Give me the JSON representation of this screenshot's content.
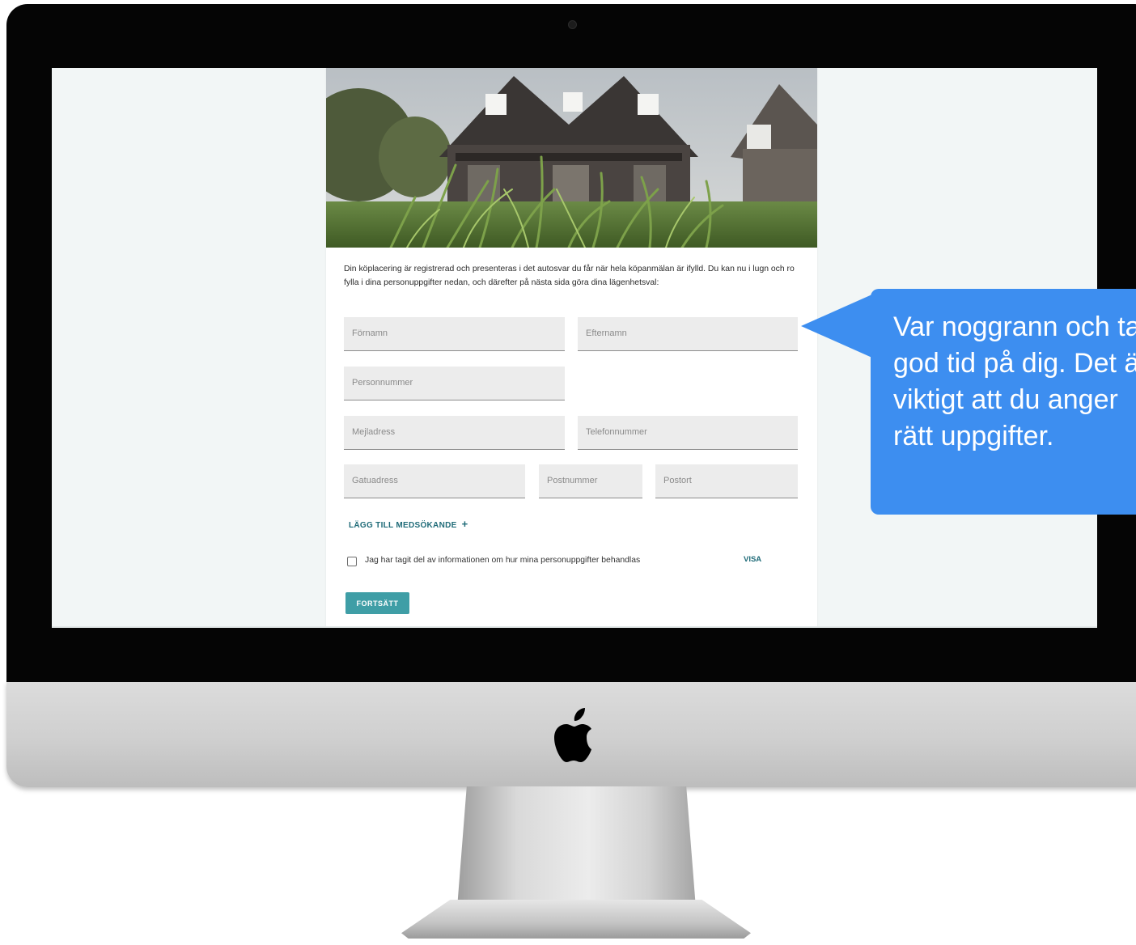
{
  "form": {
    "intro": "Din köplacering är registrerad och presenteras i det autosvar du får när hela köpanmälan är ifylld. Du kan nu i lugn och ro fylla i dina personuppgifter nedan, och därefter på nästa sida göra dina lägenhetsval:",
    "fields": {
      "first_name": "Förnamn",
      "last_name": "Efternamn",
      "personal_number": "Personnummer",
      "email": "Mejladress",
      "phone": "Telefonnummer",
      "street": "Gatuadress",
      "postal_code": "Postnummer",
      "city": "Postort"
    },
    "add_co_applicant": "LÄGG TILL MEDSÖKANDE",
    "add_icon": "plus-icon",
    "consent_label": "Jag har tagit del av informationen om hur mina personuppgifter behandlas",
    "consent_link": "VISA",
    "continue": "FORTSÄTT"
  },
  "callout": {
    "lines": [
      "Var noggrann och ta",
      "god tid på dig. Det är",
      "viktigt att du anger",
      "rätt uppgifter."
    ]
  },
  "colors": {
    "accent": "#3f9ea6",
    "link": "#1f6b78",
    "callout": "#3d8ef0"
  }
}
